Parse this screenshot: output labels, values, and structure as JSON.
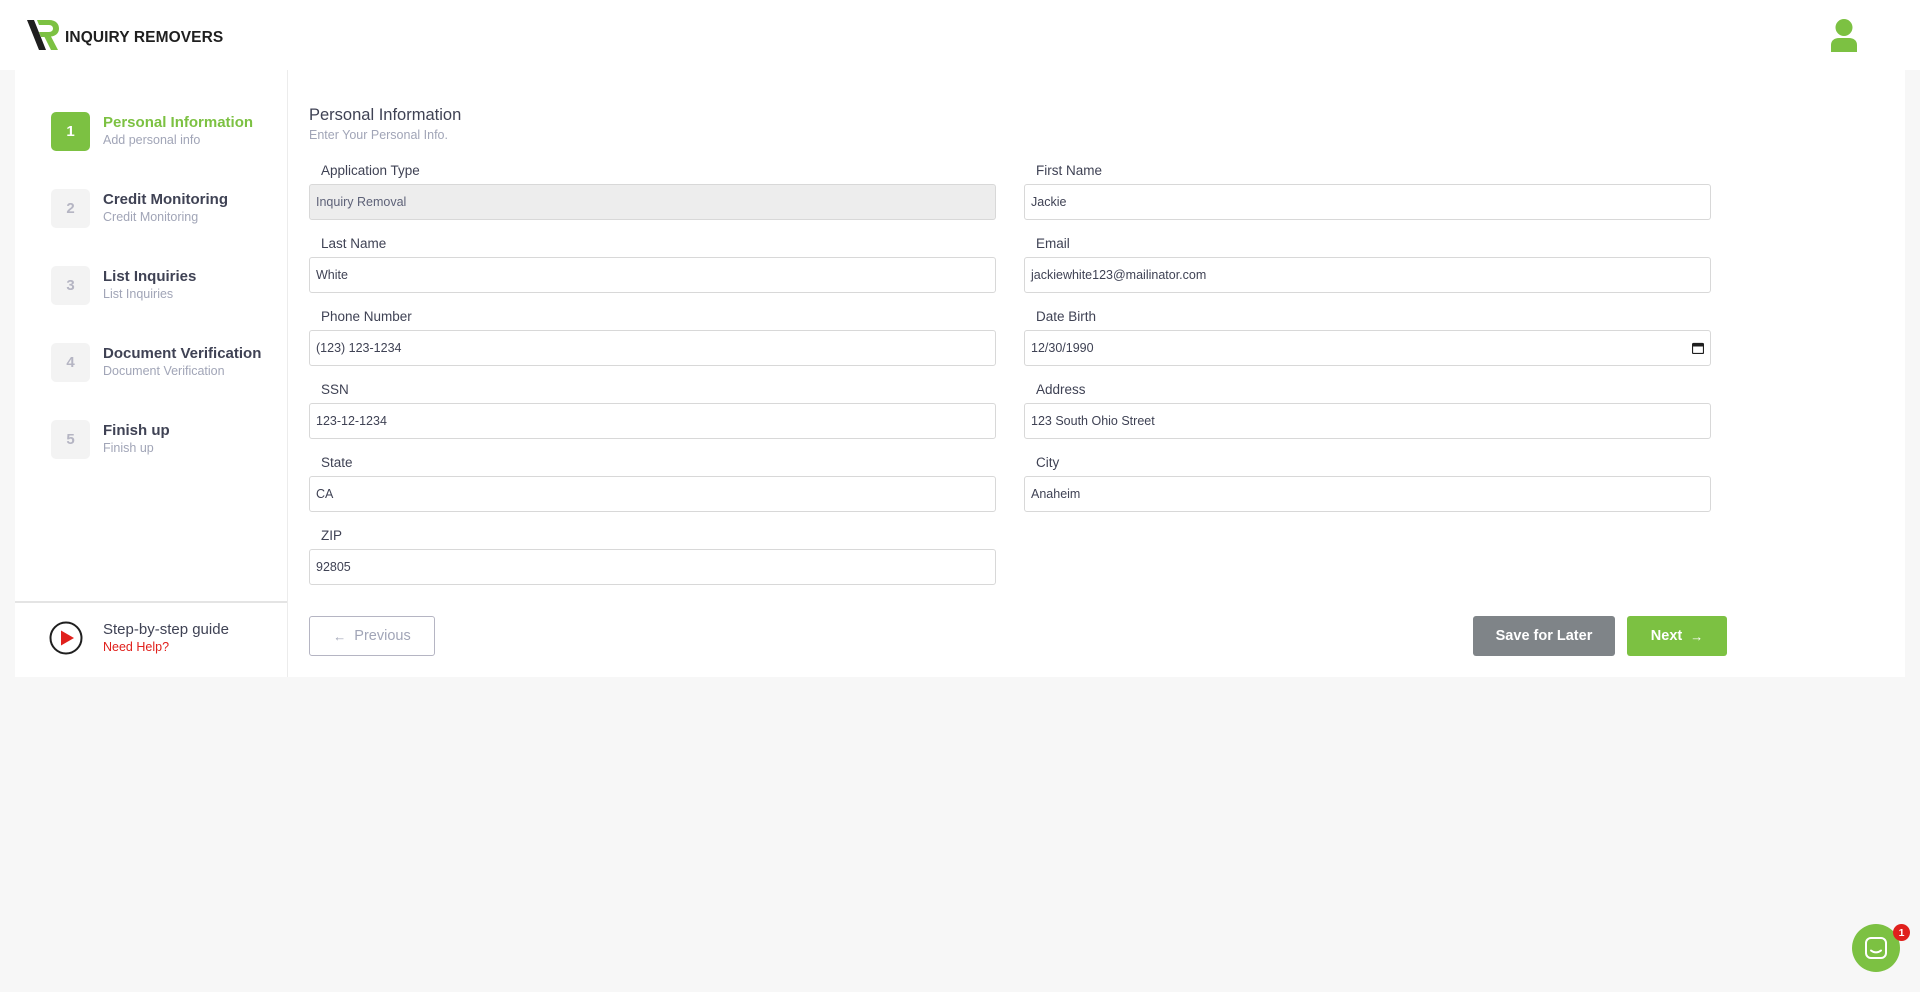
{
  "header": {
    "brand": "INQUIRY REMOVERS"
  },
  "steps": [
    {
      "number": "1",
      "title": "Personal Information",
      "subtitle": "Add personal info",
      "active": true
    },
    {
      "number": "2",
      "title": "Credit Monitoring",
      "subtitle": "Credit Monitoring",
      "active": false
    },
    {
      "number": "3",
      "title": "List Inquiries",
      "subtitle": "List Inquiries",
      "active": false
    },
    {
      "number": "4",
      "title": "Document Verification",
      "subtitle": "Document Verification",
      "active": false
    },
    {
      "number": "5",
      "title": "Finish up",
      "subtitle": "Finish up",
      "active": false
    }
  ],
  "guide": {
    "title": "Step-by-step guide",
    "help": "Need Help?"
  },
  "form": {
    "title": "Personal Information",
    "subtitle": "Enter Your Personal Info.",
    "fields": {
      "application_type": {
        "label": "Application Type",
        "value": "Inquiry Removal"
      },
      "first_name": {
        "label": "First Name",
        "value": "Jackie"
      },
      "last_name": {
        "label": "Last Name",
        "value": "White"
      },
      "email": {
        "label": "Email",
        "value": "jackiewhite123@mailinator.com"
      },
      "phone": {
        "label": "Phone Number",
        "value": "(123) 123-1234"
      },
      "dob": {
        "label": "Date Birth",
        "value": "12/30/1990"
      },
      "ssn": {
        "label": "SSN",
        "value": "123-12-1234"
      },
      "address": {
        "label": "Address",
        "value": "123 South Ohio Street"
      },
      "state": {
        "label": "State",
        "value": "CA"
      },
      "city": {
        "label": "City",
        "value": "Anaheim"
      },
      "zip": {
        "label": "ZIP",
        "value": "92805"
      }
    }
  },
  "actions": {
    "previous": "Previous",
    "save": "Save for Later",
    "next": "Next"
  },
  "chat": {
    "badge": "1"
  },
  "colors": {
    "accent": "#7cc142",
    "danger": "#e0201c",
    "secondary_button": "#7f8488"
  }
}
